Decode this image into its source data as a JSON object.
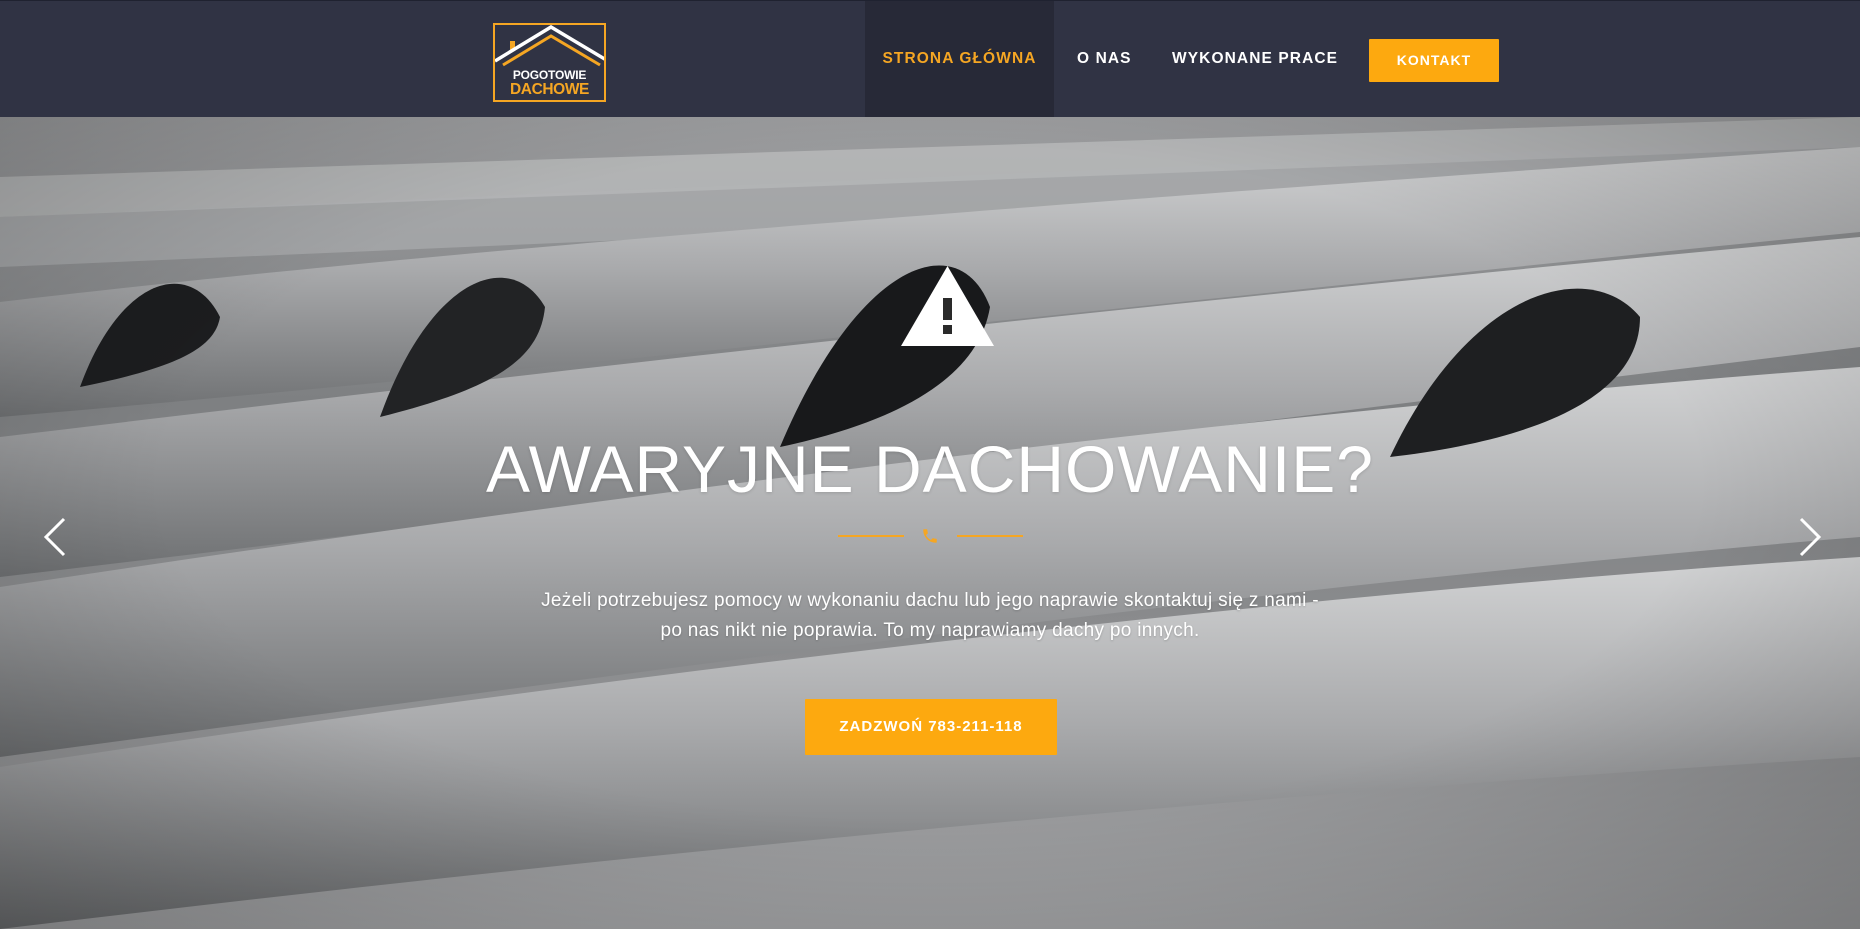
{
  "header": {
    "logo": {
      "line1": "POGOTOWIE",
      "line2": "DACHOWE"
    },
    "nav": {
      "home": "STRONA GŁÓWNA",
      "about": "O NAS",
      "works": "WYKONANE PRACE",
      "contact": "KONTAKT"
    }
  },
  "hero": {
    "icon": "warning-icon",
    "title": "AWARYJNE DACHOWANIE?",
    "divider_icon": "phone-icon",
    "text_line1": "Jeżeli potrzebujesz pomocy w wykonaniu dachu lub jego naprawie skontaktuj się z nami -",
    "text_line2": "po nas nikt nie poprawia. To my naprawiamy dachy po innych.",
    "cta_label": "ZADZWOŃ 783-211-118",
    "prev_icon": "chevron-left-icon",
    "next_icon": "chevron-right-icon"
  },
  "colors": {
    "header_bg": "#303344",
    "active_nav_bg": "#272937",
    "accent": "#fda90f",
    "text": "#ffffff"
  }
}
